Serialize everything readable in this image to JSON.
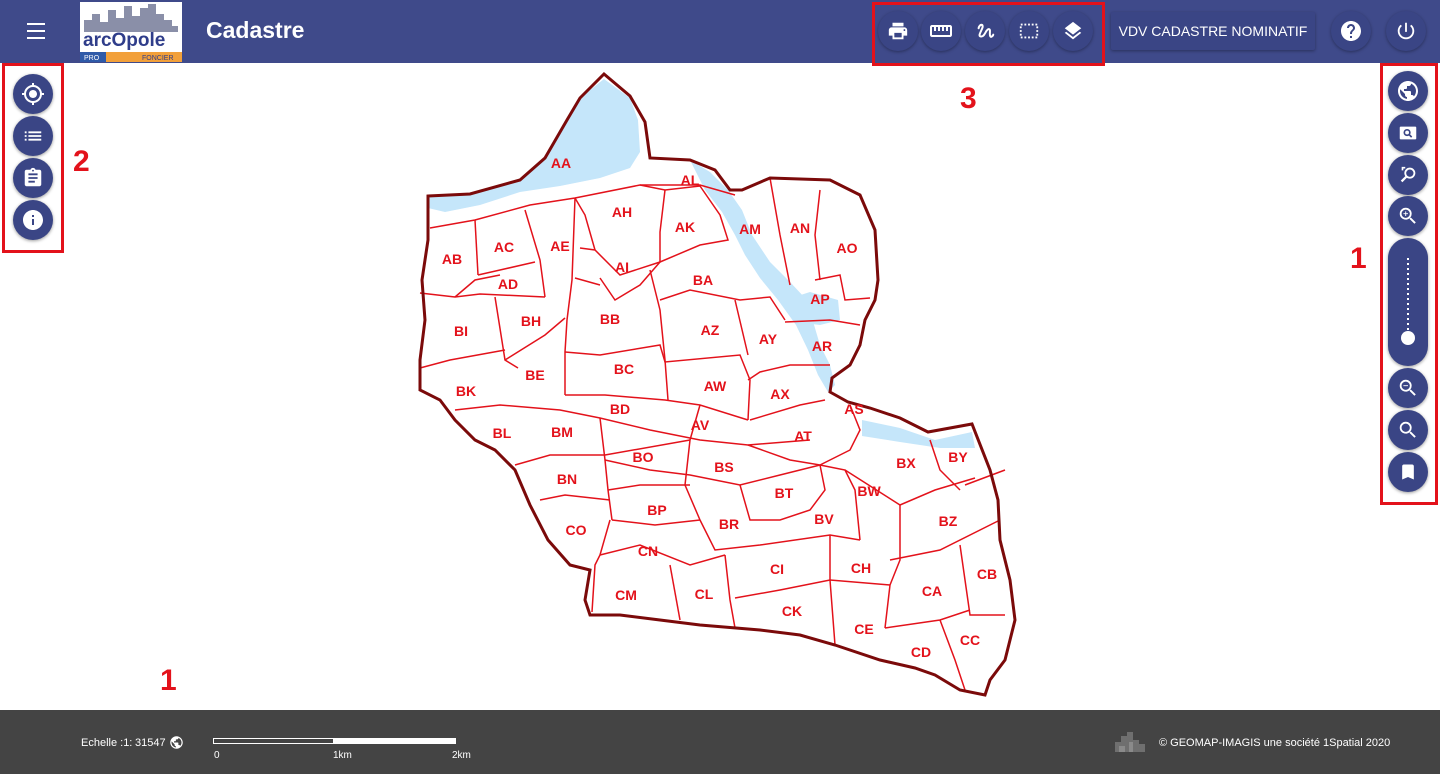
{
  "header": {
    "menu_icon": "hamburger-menu-icon",
    "logo": {
      "text": "arcOpole",
      "sub_left": "PRO",
      "sub_right": "FONCIER"
    },
    "title": "Cadastre",
    "tools": [
      {
        "name": "print-icon"
      },
      {
        "name": "ruler-icon"
      },
      {
        "name": "draw-icon"
      },
      {
        "name": "selection-icon"
      },
      {
        "name": "layers-icon"
      }
    ],
    "vdv_button": "VDV CADASTRE NOMINATIF",
    "help_icon": "help-icon",
    "power_icon": "power-icon"
  },
  "left_toolbar": [
    {
      "name": "locate-icon"
    },
    {
      "name": "list-icon"
    },
    {
      "name": "clipboard-icon"
    },
    {
      "name": "info-icon"
    }
  ],
  "right_toolbar": {
    "top": [
      {
        "name": "globe-icon"
      },
      {
        "name": "zoom-box-icon"
      },
      {
        "name": "zoom-previous-icon"
      },
      {
        "name": "zoom-in-icon"
      }
    ],
    "slider_level": 0.15,
    "bottom": [
      {
        "name": "zoom-out-icon"
      },
      {
        "name": "search-icon"
      },
      {
        "name": "bookmark-icon"
      }
    ]
  },
  "annotations": {
    "one_right": "1",
    "two": "2",
    "three": "3",
    "one_bottom": "1"
  },
  "map": {
    "parcels": [
      "AA",
      "AL",
      "AH",
      "AK",
      "AM",
      "AN",
      "AO",
      "AB",
      "AC",
      "AE",
      "AI",
      "AD",
      "BA",
      "AP",
      "BI",
      "BH",
      "BB",
      "AZ",
      "AY",
      "AR",
      "BK",
      "BE",
      "BC",
      "AW",
      "AX",
      "AS",
      "BL",
      "BM",
      "BD",
      "AV",
      "AT",
      "BO",
      "BS",
      "BX",
      "BY",
      "BN",
      "BT",
      "BW",
      "BP",
      "BR",
      "BV",
      "BZ",
      "CO",
      "CN",
      "CI",
      "CH",
      "CB",
      "CM",
      "CL",
      "CA",
      "CK",
      "CE",
      "CD",
      "CC"
    ],
    "colors": {
      "boundary": "#7b0a0a",
      "parcel_line": "#e3121b",
      "water": "#c5e6fa",
      "label": "#e3121b"
    }
  },
  "footer": {
    "scale_label": "Echelle :1:",
    "scale_value": "31547",
    "scale_ticks": [
      "0",
      "1km",
      "2km"
    ],
    "copyright": "© GEOMAP-IMAGIS une société 1Spatial 2020"
  }
}
